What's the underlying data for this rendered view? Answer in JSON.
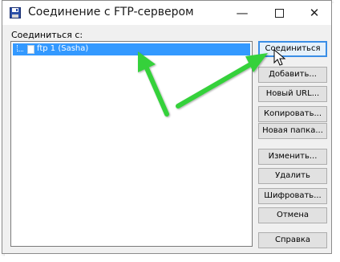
{
  "window": {
    "title": "Соединение с FTP-сервером",
    "minimize": "—",
    "close": "✕"
  },
  "connect_to_label": "Соединиться с:",
  "list": {
    "items": [
      {
        "label": "ftp 1 (Sasha)",
        "selected": true
      }
    ]
  },
  "buttons": {
    "connect": "Соединиться",
    "add": "Добавить...",
    "new_url": "Новый URL...",
    "copy": "Копировать...",
    "new_folder": "Новая папка...",
    "edit": "Изменить...",
    "delete": "Удалить",
    "encrypt": "Шифровать...",
    "cancel": "Отмена",
    "help": "Справка"
  },
  "colors": {
    "selection": "#3399ff",
    "arrow": "#36d13a",
    "default_button_border": "#3a8ee6"
  }
}
